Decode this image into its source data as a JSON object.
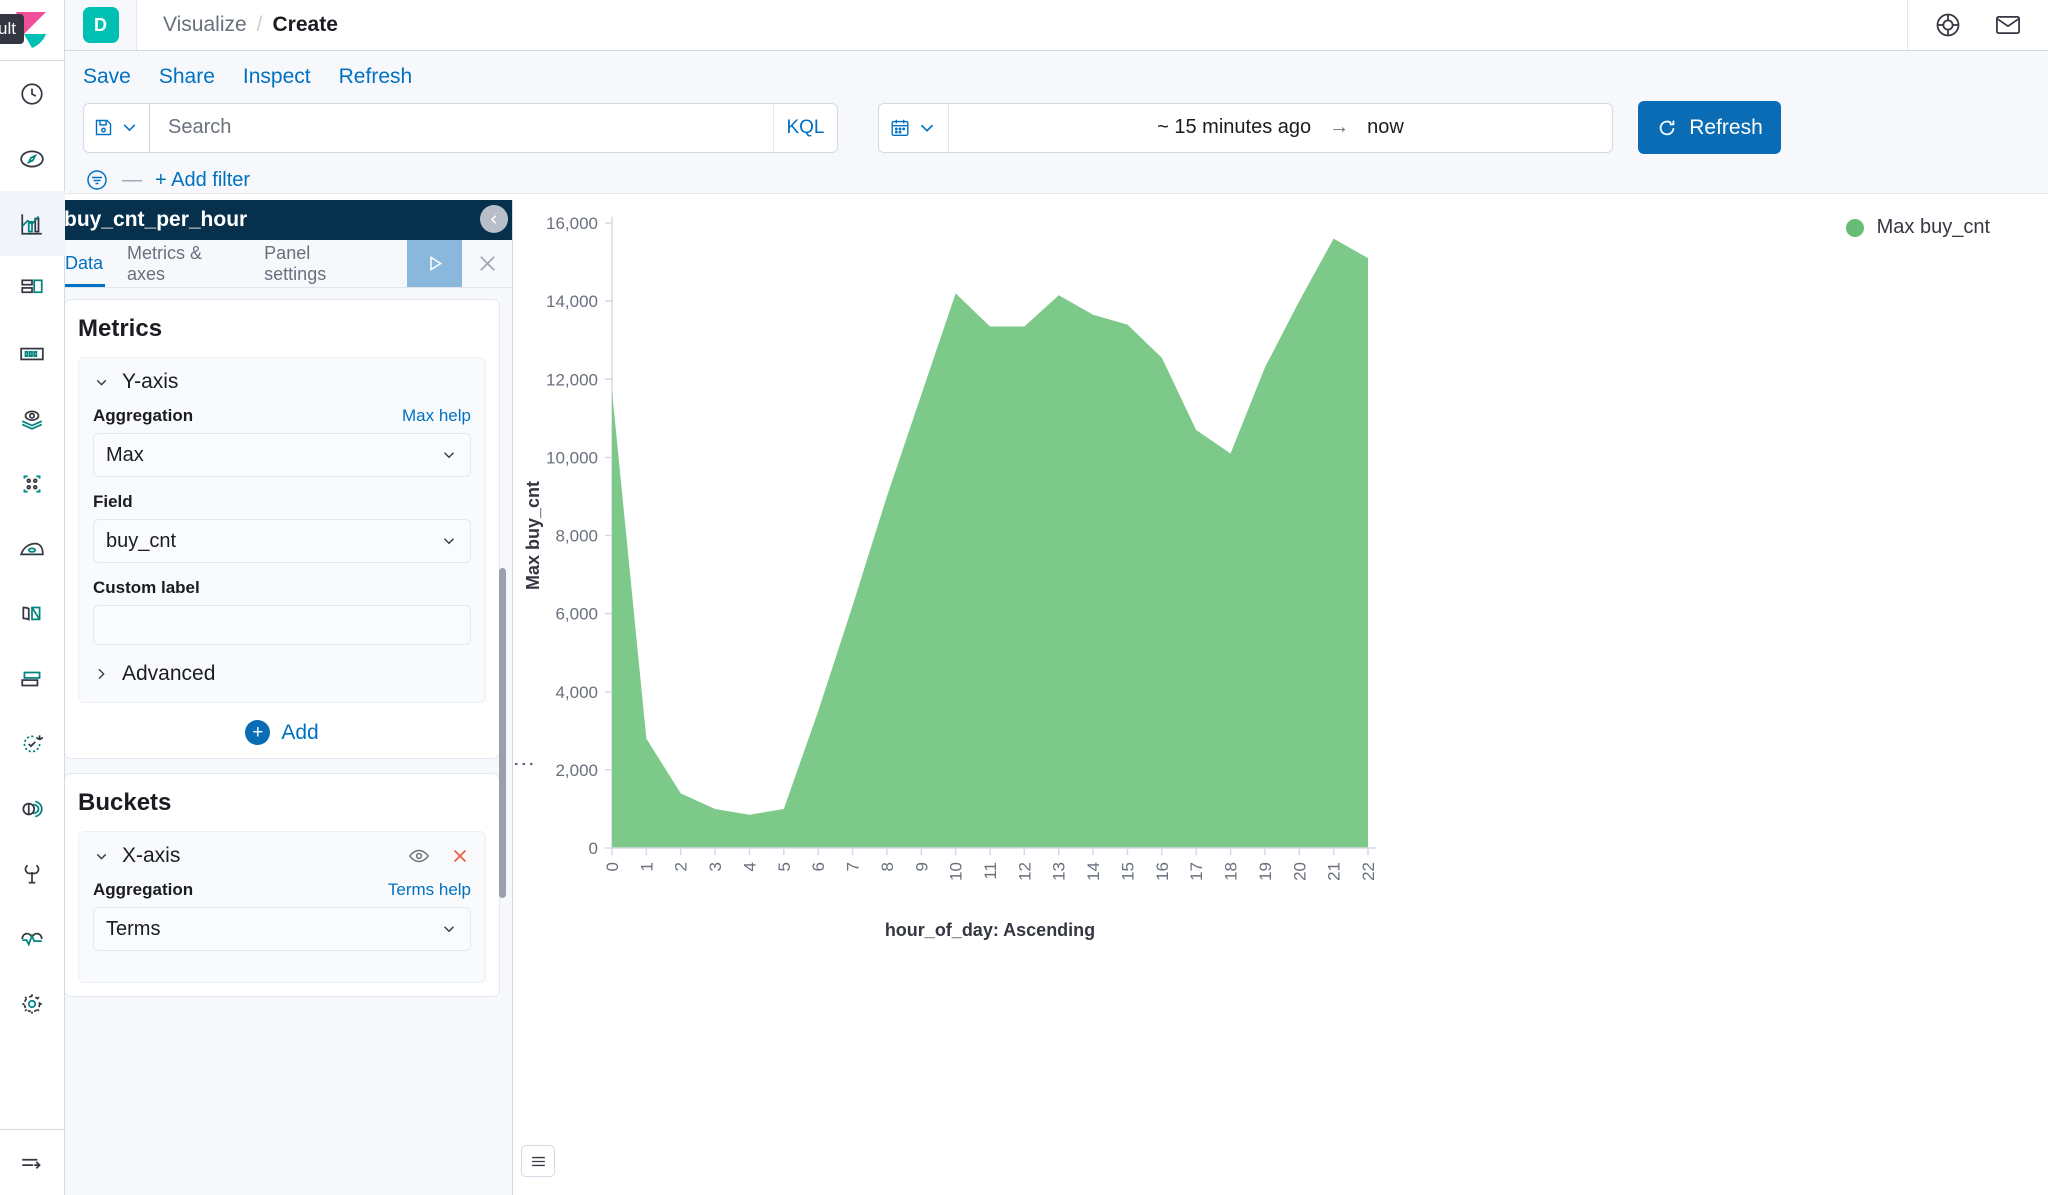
{
  "branding": {
    "default_badge": "ult",
    "app_badge_letter": "D"
  },
  "header": {
    "breadcrumb_parent": "Visualize",
    "breadcrumb_separator": "/",
    "breadcrumb_current": "Create",
    "help_icon": "help-circle-icon",
    "mail_icon": "mail-icon"
  },
  "menu": {
    "items": [
      {
        "label": "Save",
        "name": "save"
      },
      {
        "label": "Share",
        "name": "share"
      },
      {
        "label": "Inspect",
        "name": "inspect"
      },
      {
        "label": "Refresh",
        "name": "refresh"
      }
    ]
  },
  "query_bar": {
    "saved_query_icon": "save-disk-icon",
    "search_placeholder": "Search",
    "search_value": "",
    "language_badge": "KQL",
    "calendar_icon": "calendar-icon",
    "date_from": "~ 15 minutes ago",
    "date_arrow": "→",
    "date_to": "now",
    "refresh_button": "Refresh",
    "refresh_icon": "refresh-icon"
  },
  "filter_bar": {
    "filter_icon": "filter-icon",
    "dash": "—",
    "add_filter": "+ Add filter"
  },
  "sidebar": {
    "items": [
      {
        "name": "recently-viewed",
        "icon": "clock-icon"
      },
      {
        "name": "discover",
        "icon": "compass-icon"
      },
      {
        "name": "visualize",
        "icon": "bar-chart-icon",
        "active": true
      },
      {
        "name": "dashboard",
        "icon": "dashboard-icon"
      },
      {
        "name": "canvas",
        "icon": "canvas-icon"
      },
      {
        "name": "maps",
        "icon": "map-marker-layers-icon"
      },
      {
        "name": "machine-learning",
        "icon": "ml-nodes-icon"
      },
      {
        "name": "infrastructure",
        "icon": "infra-icon"
      },
      {
        "name": "logs",
        "icon": "logs-icon"
      },
      {
        "name": "apm",
        "icon": "apm-icon"
      },
      {
        "name": "uptime",
        "icon": "uptime-icon"
      },
      {
        "name": "siem",
        "icon": "siem-icon"
      },
      {
        "name": "dev-tools",
        "icon": "wrench-icon"
      },
      {
        "name": "monitoring",
        "icon": "heartbeat-icon"
      },
      {
        "name": "management",
        "icon": "gear-icon"
      }
    ],
    "collapse": {
      "name": "collapse-nav",
      "icon": "arrow-right-lines-icon"
    }
  },
  "editor": {
    "title": "buy_cnt_per_hour",
    "tabs": [
      {
        "label": "Data",
        "name": "data",
        "active": true
      },
      {
        "label": "Metrics & axes",
        "name": "metrics-axes",
        "active": false
      },
      {
        "label": "Panel settings",
        "name": "panel-settings",
        "active": false
      }
    ],
    "apply_icon": "play-icon",
    "close_icon": "close-icon",
    "metrics": {
      "heading": "Metrics",
      "y_axis": {
        "group_label": "Y-axis",
        "aggregation_label": "Aggregation",
        "aggregation_help": "Max help",
        "aggregation_value": "Max",
        "field_label": "Field",
        "field_value": "buy_cnt",
        "custom_label_label": "Custom label",
        "custom_label_value": "",
        "advanced_label": "Advanced"
      },
      "add_label": "Add"
    },
    "buckets": {
      "heading": "Buckets",
      "x_axis": {
        "group_label": "X-axis",
        "eye_icon": "eye-icon",
        "remove_icon": "remove-x-icon",
        "aggregation_label": "Aggregation",
        "aggregation_help": "Terms help",
        "aggregation_value": "Terms"
      }
    }
  },
  "chart_panel": {
    "collapse_icon": "chevron-left-circle-icon",
    "legend_label": "Max buy_cnt",
    "legend_color": "#68bc76",
    "legend_toggle_icon": "list-icon"
  },
  "chart_data": {
    "type": "area",
    "title": "",
    "xlabel": "hour_of_day: Ascending",
    "ylabel": "Max buy_cnt",
    "series_name": "Max buy_cnt",
    "color": "#7cc98a",
    "grid": false,
    "legend_position": "top-right",
    "ylim": [
      0,
      16000
    ],
    "ytick_values": [
      0,
      2000,
      4000,
      6000,
      8000,
      10000,
      12000,
      14000,
      16000
    ],
    "ytick_labels": [
      "0",
      "2,000",
      "4,000",
      "6,000",
      "8,000",
      "10,000",
      "12,000",
      "14,000",
      "16,000"
    ],
    "categories": [
      "0",
      "1",
      "2",
      "3",
      "4",
      "5",
      "6",
      "7",
      "8",
      "9",
      "10",
      "11",
      "12",
      "13",
      "14",
      "15",
      "16",
      "17",
      "18",
      "19",
      "20",
      "21",
      "22"
    ],
    "values": [
      11700,
      2800,
      1400,
      1000,
      850,
      1000,
      3500,
      6200,
      9000,
      11600,
      14200,
      13350,
      13350,
      14150,
      13650,
      13400,
      12550,
      10700,
      10100,
      12300,
      14000,
      15600,
      15100
    ]
  }
}
